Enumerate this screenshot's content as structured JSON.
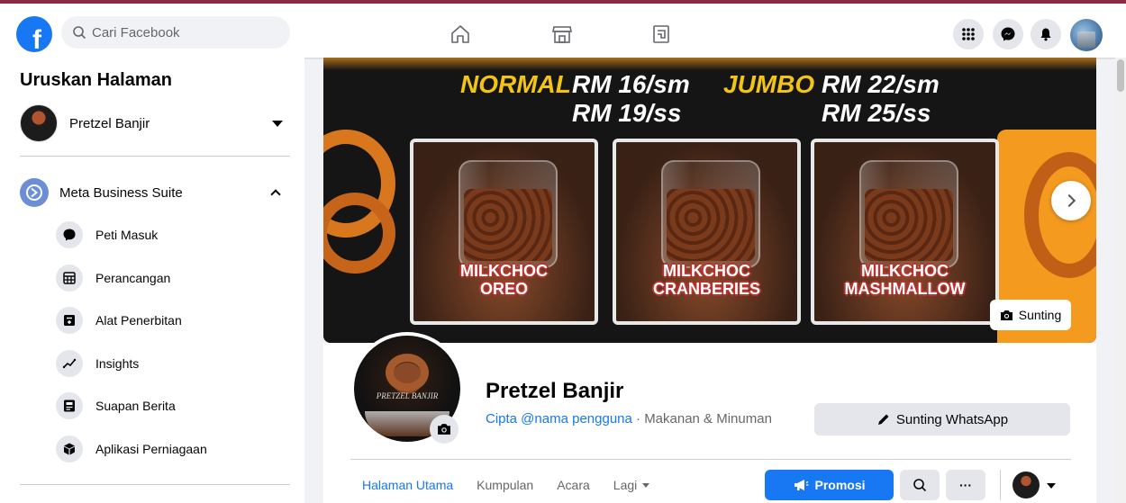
{
  "topbar": {
    "logo": "f",
    "search_placeholder": "Cari Facebook",
    "nav_icons": [
      "home-icon",
      "marketplace-icon",
      "pages-icon"
    ],
    "right_icons": [
      "menu-grid-icon",
      "messenger-icon",
      "notification-bell-icon"
    ]
  },
  "sidebar": {
    "title": "Uruskan Halaman",
    "page_name": "Pretzel Banjir",
    "mbs_label": "Meta Business Suite",
    "items": [
      {
        "label": "Peti Masuk",
        "icon": "inbox-icon"
      },
      {
        "label": "Perancangan",
        "icon": "planner-icon"
      },
      {
        "label": "Alat Penerbitan",
        "icon": "publishing-tools-icon"
      },
      {
        "label": "Insights",
        "icon": "insights-icon"
      },
      {
        "label": "Suapan Berita",
        "icon": "news-feed-icon"
      },
      {
        "label": "Aplikasi Perniagaan",
        "icon": "business-apps-icon"
      }
    ]
  },
  "cover": {
    "normal_label": "NORMAL",
    "normal_price_sm": "RM 16/sm",
    "normal_price_ss": "RM 19/ss",
    "jumbo_label": "JUMBO",
    "jumbo_price_sm": "RM 22/sm",
    "jumbo_price_ss": "RM 25/ss",
    "products": [
      {
        "line1": "MILKCHOC",
        "line2": "OREO"
      },
      {
        "line1": "MILKCHOC",
        "line2": "CRANBERIES"
      },
      {
        "line1": "MILKCHOC",
        "line2": "MASHMALLOW"
      }
    ],
    "edit_label": "Sunting"
  },
  "profile": {
    "name": "Pretzel Banjir",
    "pic_text": "PRETZEL BANJIR",
    "username_link": "Cipta @nama pengguna",
    "separator": " · ",
    "category": "Makanan & Minuman",
    "whatsapp_button": "Sunting WhatsApp"
  },
  "tabs": [
    {
      "label": "Halaman Utama",
      "active": true
    },
    {
      "label": "Kumpulan",
      "active": false
    },
    {
      "label": "Acara",
      "active": false
    },
    {
      "label": "Lagi",
      "active": false
    }
  ],
  "actions": {
    "promo_label": "Promosi",
    "more_label": "···"
  },
  "colors": {
    "brand_blue": "#1877f2",
    "top_accent": "#8a2b43",
    "cover_orange": "#f39a1f",
    "price_yellow": "#f2c418"
  }
}
